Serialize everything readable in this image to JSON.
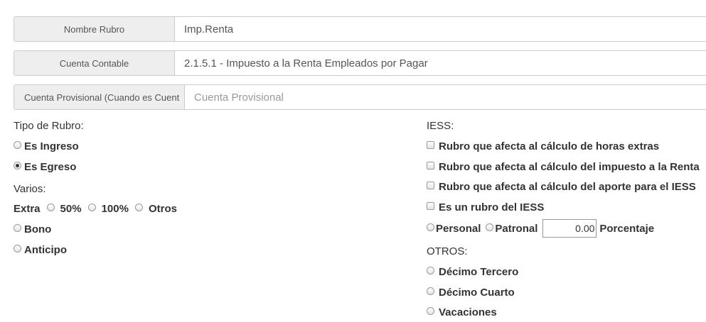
{
  "form": {
    "nombre_rubro": {
      "label": "Nombre Rubro",
      "value": "Imp.Renta"
    },
    "cuenta_contable": {
      "label": "Cuenta Contable",
      "value": "2.1.5.1 - Impuesto a la Renta Empleados por Pagar"
    },
    "cuenta_provisional": {
      "label": "Cuenta Provisional (Cuando es Cuent",
      "placeholder": "Cuenta Provisional",
      "value": ""
    }
  },
  "tipo_rubro": {
    "title": "Tipo de Rubro:",
    "options": [
      {
        "label": "Es Ingreso",
        "checked": false
      },
      {
        "label": "Es Egreso",
        "checked": true
      }
    ]
  },
  "varios": {
    "title": "Varios:",
    "extra_label": "Extra",
    "extra_options": [
      "50%",
      "100%",
      "Otros"
    ],
    "bono": "Bono",
    "anticipo": "Anticipo"
  },
  "iess": {
    "title": "IESS:",
    "checkboxes": [
      "Rubro que afecta al cálculo de horas extras",
      "Rubro que afecta al cálculo del impuesto a la Renta",
      "Rubro que afecta al cálculo del aporte para el IESS",
      "Es un rubro del IESS"
    ],
    "personal": "Personal",
    "patronal": "Patronal",
    "porcentaje_value": "0.00",
    "porcentaje_label": "Porcentaje"
  },
  "otros": {
    "title": "OTROS:",
    "options": [
      "Décimo Tercero",
      "Décimo Cuarto",
      "Vacaciones"
    ]
  }
}
